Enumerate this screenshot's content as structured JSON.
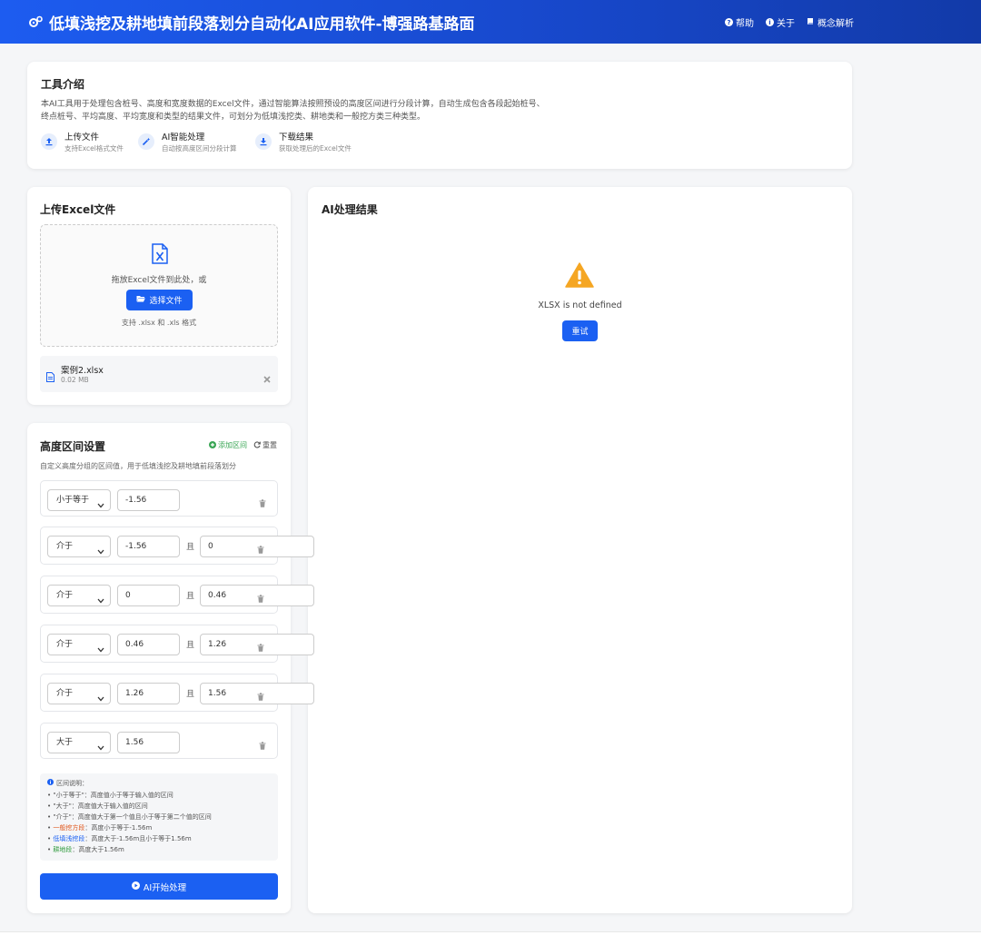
{
  "header": {
    "title": "低填浅挖及耕地填前段落划分自动化AI应用软件-博强路基路面",
    "nav": [
      {
        "label": "帮助",
        "icon": "question-circle-icon"
      },
      {
        "label": "关于",
        "icon": "info-circle-icon"
      },
      {
        "label": "概念解析",
        "icon": "book-icon"
      }
    ]
  },
  "intro": {
    "title": "工具介绍",
    "text": "本AI工具用于处理包含桩号、高度和宽度数据的Excel文件，通过智能算法按照预设的高度区间进行分段计算，自动生成包含各段起始桩号、终点桩号、平均高度、平均宽度和类型的结果文件，可划分为低填浅挖类、耕地类和一般挖方类三种类型。",
    "features": [
      {
        "title": "上传文件",
        "sub": "支持Excel格式文件",
        "icon": "upload-icon"
      },
      {
        "title": "AI智能处理",
        "sub": "自动按高度区间分段计算",
        "icon": "magic-wand-icon"
      },
      {
        "title": "下载结果",
        "sub": "获取处理后的Excel文件",
        "icon": "download-icon"
      }
    ]
  },
  "upload": {
    "title": "上传Excel文件",
    "drop_text": "拖放Excel文件到此处，或",
    "choose_button": "选择文件",
    "format_hint": "支持 .xlsx 和 .xls 格式",
    "file_name": "案例2.xlsx",
    "file_size": "0.02 MB"
  },
  "ranges": {
    "title": "高度区间设置",
    "add_label": "添加区间",
    "reset_label": "重置",
    "subtitle": "自定义高度分组的区间值，用于低填浅挖及耕地填前段落划分",
    "and_label": "且",
    "rows": [
      {
        "op": "小于等于",
        "v1": "-1.56",
        "v2": null
      },
      {
        "op": "介于",
        "v1": "-1.56",
        "v2": "0"
      },
      {
        "op": "介于",
        "v1": "0",
        "v2": "0.46"
      },
      {
        "op": "介于",
        "v1": "0.46",
        "v2": "1.26"
      },
      {
        "op": "介于",
        "v1": "1.26",
        "v2": "1.56"
      },
      {
        "op": "大于",
        "v1": "1.56",
        "v2": null
      }
    ],
    "notes_title": "区间说明：",
    "notes": [
      {
        "highlight": "",
        "text": "\"小于等于\"：高度值小于等于输入值的区间"
      },
      {
        "highlight": "",
        "text": "\"大于\"：高度值大于输入值的区间"
      },
      {
        "highlight": "",
        "text": "\"介于\"：高度值大于第一个值且小于等于第二个值的区间"
      },
      {
        "highlight": "一般挖方段",
        "text": "：高度小于等于-1.56m",
        "color": "#e0561b"
      },
      {
        "highlight": "低填浅挖段",
        "text": "：高度大于-1.56m且小于等于1.56m",
        "color": "#1b60f2"
      },
      {
        "highlight": "耕地段",
        "text": "：高度大于1.56m",
        "color": "#2e9a3c"
      }
    ],
    "process_button": "AI开始处理"
  },
  "result": {
    "title": "AI处理结果",
    "error_message": "XLSX is not defined",
    "retry_button": "重试"
  },
  "colors": {
    "primary": "#1b60f2",
    "header": "#1747c9",
    "warning": "#f5a623",
    "add": "#3aa655"
  }
}
